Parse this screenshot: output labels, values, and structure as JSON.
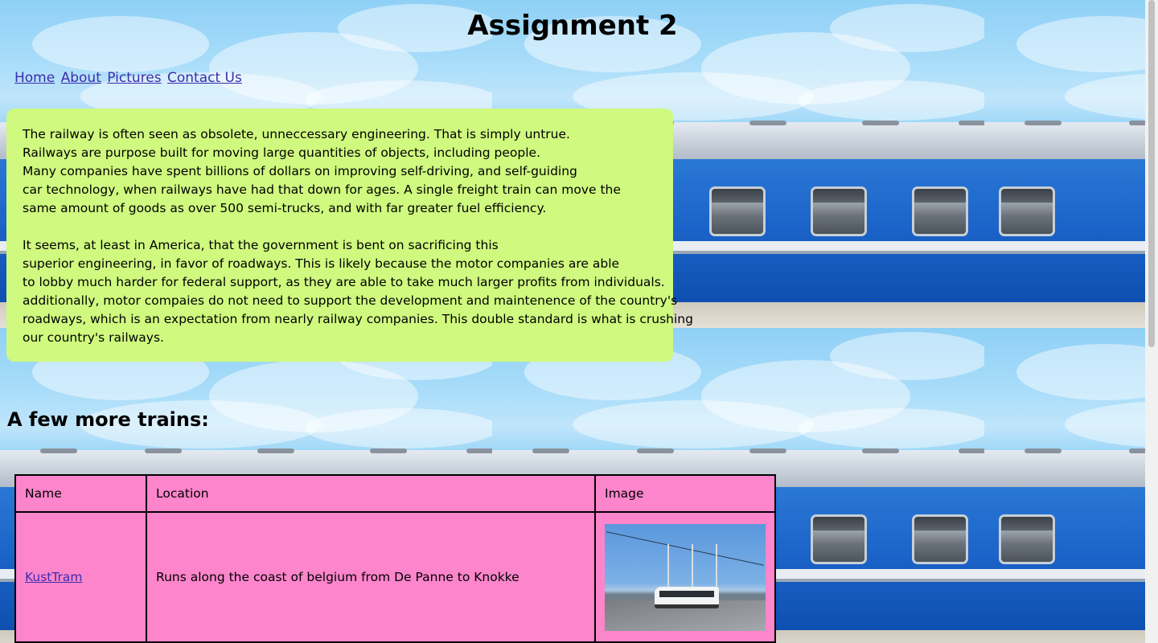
{
  "page_title": "Assignment 2",
  "nav": {
    "home": "Home",
    "about": "About",
    "pictures": "Pictures",
    "contact": "Contact Us"
  },
  "intro": {
    "paragraph1_lines": [
      "The railway is often seen as obsolete, unneccessary engineering. That is simply untrue.",
      "Railways are purpose built for moving large quantities of objects, including people.",
      "Many companies have spent billions of dollars on improving self-driving, and self-guiding",
      "car technology, when railways have had that down for ages. A single freight train can move the",
      "same amount of goods as over 500 semi-trucks, and with far greater fuel efficiency."
    ],
    "paragraph2_lines": [
      "It seems, at least in America, that the government is bent on sacrificing this",
      "superior engineering, in favor of roadways. This is likely because the motor companies are able",
      "to lobby much harder for federal support, as they are able to take much larger profits from individuals.",
      "additionally, motor compaies do not need to support the development and maintenence of the country's",
      "roadways, which is an expectation from nearly railway companies. This double standard is what is crushing",
      "our country's railways."
    ]
  },
  "more_heading": "A few more trains:",
  "table": {
    "headers": [
      "Name",
      "Location",
      "Image"
    ],
    "rows": [
      {
        "name": "KustTram",
        "location": "Runs along the coast of belgium from De Panne to Knokke",
        "image_icon": "tram-photo"
      }
    ]
  },
  "colors": {
    "intro_bg": "#cff97f",
    "table_bg": "#fc85cc",
    "link": "#3d2dac"
  }
}
